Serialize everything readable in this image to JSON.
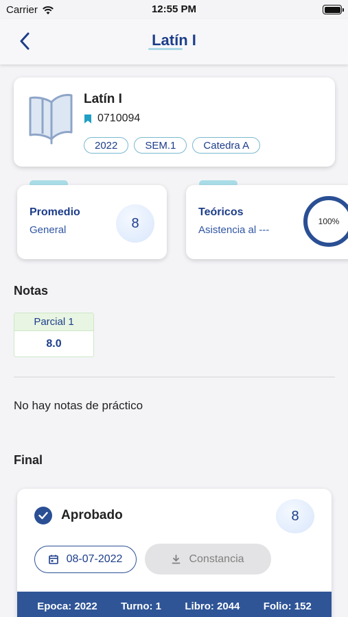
{
  "status_bar": {
    "carrier": "Carrier",
    "time": "12:55 PM"
  },
  "nav": {
    "title": "Latín I"
  },
  "course": {
    "title": "Latín I",
    "code": "0710094",
    "chips": [
      "2022",
      "SEM.1",
      "Catedra A"
    ]
  },
  "stats": {
    "average": {
      "title": "Promedio",
      "subtitle": "General",
      "value": "8"
    },
    "theory": {
      "title": "Teóricos",
      "subtitle": "Asistencia al ---",
      "percent": "100%"
    }
  },
  "notes": {
    "title": "Notas",
    "grades": [
      {
        "label": "Parcial 1",
        "value": "8.0"
      }
    ],
    "empty_practice": "No hay notas de práctico"
  },
  "final": {
    "title": "Final",
    "status": "Aprobado",
    "grade": "8",
    "date": "08-07-2022",
    "certificate_label": "Constancia",
    "footer": [
      "Epoca: 2022",
      "Turno: 1",
      "Libro: 2044",
      "Folio: 152"
    ]
  },
  "colors": {
    "primary": "#1c3d8a",
    "accent": "#a9dde7",
    "footer": "#2f5597"
  }
}
